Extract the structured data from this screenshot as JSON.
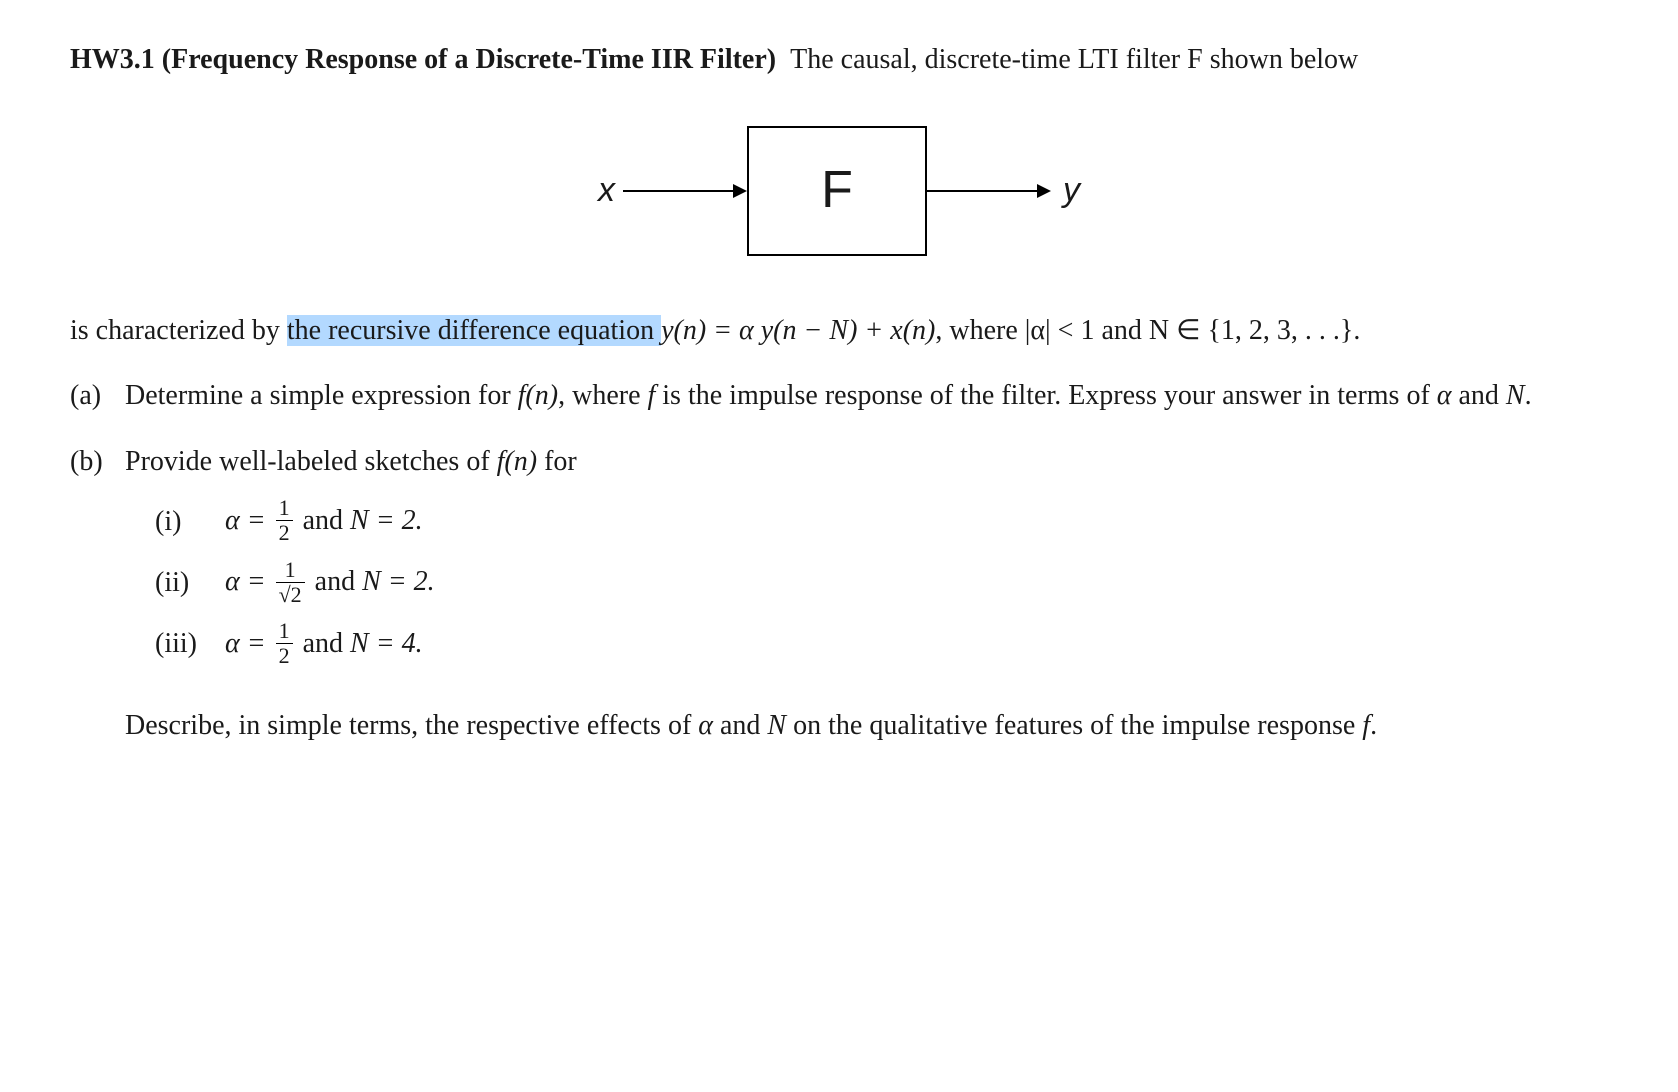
{
  "header": {
    "problem_num": "HW3.1",
    "title": "(Frequency Response of a Discrete-Time IIR Filter)",
    "intro_text": "The causal, discrete-time LTI filter F shown below"
  },
  "diagram": {
    "input_label": "x",
    "box_label": "F",
    "output_label": "y"
  },
  "characterization": {
    "prefix": "is characterized by ",
    "highlighted": "the recursive difference equation ",
    "equation": "y(n) = α y(n − N) + x(n)",
    "suffix": ",",
    "where_text": "where |α| < 1 and N ∈ {1, 2, 3, . . .}."
  },
  "parts": {
    "a": {
      "label": "(a)",
      "text_1": "Determine a simple expression for ",
      "math_1": "f(n)",
      "text_2": ", where ",
      "math_2": "f",
      "text_3": " is the impulse response of the filter. Express your answer in terms of ",
      "math_3": "α",
      "text_4": " and ",
      "math_4": "N",
      "text_5": "."
    },
    "b": {
      "label": "(b)",
      "text_1": "Provide well-labeled sketches of ",
      "math_1": "f(n)",
      "text_2": " for",
      "subparts": {
        "i": {
          "label": "(i)",
          "alpha_prefix": "α = ",
          "frac_num": "1",
          "frac_den": "2",
          "and_text": " and ",
          "N_text": "N = 2."
        },
        "ii": {
          "label": "(ii)",
          "alpha_prefix": "α = ",
          "frac_num": "1",
          "frac_den": "√2",
          "and_text": " and ",
          "N_text": "N = 2."
        },
        "iii": {
          "label": "(iii)",
          "alpha_prefix": "α = ",
          "frac_num": "1",
          "frac_den": "2",
          "and_text": " and ",
          "N_text": "N = 4."
        }
      },
      "closing_1": "Describe, in simple terms, the respective effects of ",
      "closing_alpha": "α",
      "closing_2": " and ",
      "closing_N": "N",
      "closing_3": " on the qualitative features of the impulse response ",
      "closing_f": "f",
      "closing_4": "."
    }
  }
}
